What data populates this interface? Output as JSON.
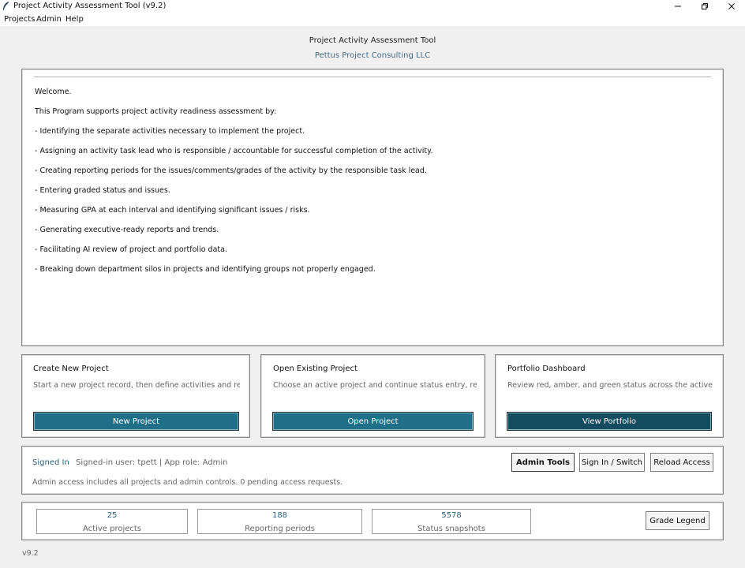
{
  "window": {
    "title": "Project Activity Assessment Tool (v9.2)",
    "icons": {
      "app": "feather-icon",
      "minimize": "minimize-icon",
      "restore": "restore-icon",
      "close": "close-icon"
    }
  },
  "menu": {
    "items": [
      "Projects",
      "Admin",
      "Help"
    ]
  },
  "header": {
    "title": "Project Activity Assessment Tool",
    "subtitle": "Pettus Project Consulting LLC"
  },
  "welcome": {
    "lines": [
      "Welcome.",
      "This Program supports project activity readiness assessment by:",
      "- Identifying the separate activities necessary to implement the project.",
      "- Assigning an activity task lead who is responsible / accountable for successful completion of the activity.",
      "- Creating reporting periods for the issues/comments/grades of the activity by the responsible task lead.",
      "- Entering graded status and issues.",
      "- Measuring GPA at each interval and identifying significant issues / risks.",
      "- Generating executive-ready reports and trends.",
      "- Facilitating AI review of project and portfolio data.",
      "- Breaking down department silos in projects and identifying groups not properly engaged."
    ]
  },
  "cards": [
    {
      "title": "Create New Project",
      "description": "Start a new project record, then define activities and reporti",
      "button": "New Project"
    },
    {
      "title": "Open Existing Project",
      "description": "Choose an active project and continue status entry, reports",
      "button": "Open Project"
    },
    {
      "title": "Portfolio Dashboard",
      "description": "Review red, amber, and green status across the active proje",
      "button": "View Portfolio"
    }
  ],
  "colors": {
    "button_primary": "#1f6f88",
    "button_dark": "#134b5f",
    "accent_text": "#2b5f7a"
  },
  "auth": {
    "label": "Signed In",
    "user_info": "Signed-in user: tpett | App role: Admin",
    "note": "Admin access includes all projects and admin controls. 0 pending access requests.",
    "buttons": {
      "admin_tools": "Admin Tools",
      "sign_in": "Sign In / Switch",
      "reload": "Reload Access"
    }
  },
  "stats": [
    {
      "value": "25",
      "label": "Active projects"
    },
    {
      "value": "188",
      "label": "Reporting periods"
    },
    {
      "value": "5578",
      "label": "Status snapshots"
    }
  ],
  "grade_legend_button": "Grade Legend",
  "version": "v9.2"
}
